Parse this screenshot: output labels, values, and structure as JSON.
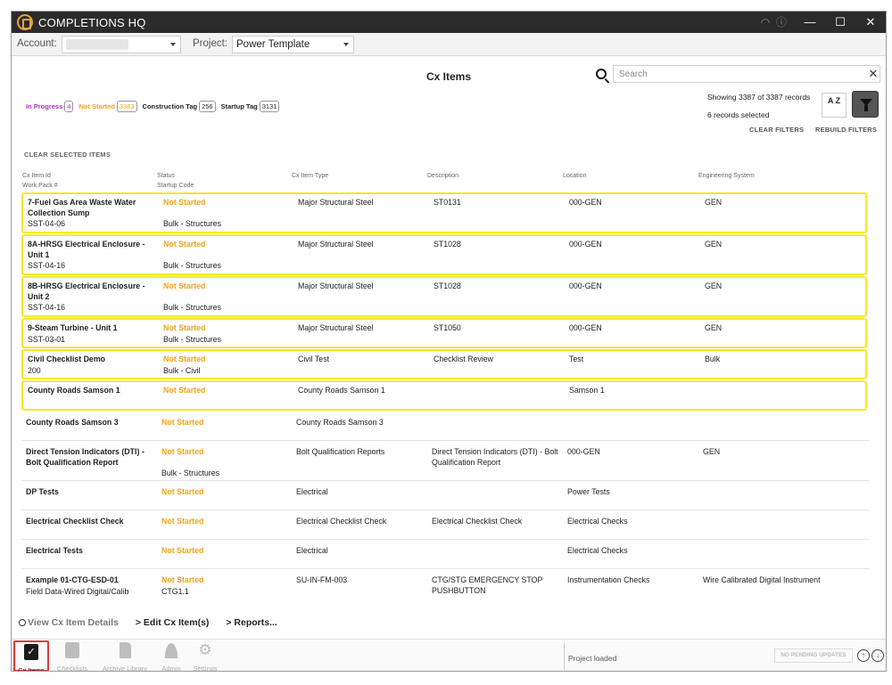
{
  "app": {
    "title": "COMPLETIONS HQ",
    "titlebar_icons": [
      "wifi-icon",
      "info-icon"
    ]
  },
  "account": {
    "label": "Account:",
    "value": ""
  },
  "project": {
    "label": "Project:",
    "value": "Power Template"
  },
  "page": {
    "title": "Cx Items"
  },
  "search": {
    "placeholder": "Search",
    "value": "",
    "clear": "✕"
  },
  "chips": [
    {
      "label": "In Progress",
      "count": "4",
      "color": "#b02cc7"
    },
    {
      "label": "Not Started",
      "count": "3383",
      "color": "#f2a31d"
    },
    {
      "label": "Construction Tag",
      "count": "256",
      "color": "#222222"
    },
    {
      "label": "Startup Tag",
      "count": "3131",
      "color": "#222222"
    }
  ],
  "records": {
    "count_text": "Showing 3387 of 3387 records",
    "selected_text": "6 records selected"
  },
  "sort_label": "A Z",
  "links": {
    "clear_filters": "CLEAR FILTERS",
    "rebuild_filters": "REBUILD FILTERS",
    "clear_selected": "CLEAR SELECTED ITEMS"
  },
  "columns": {
    "id": "Cx Item Id",
    "work_pack": "Work Pack #",
    "status": "Status",
    "startup_code": "Startup Code",
    "type": "Cx Item Type",
    "description": "Description",
    "location": "Location",
    "eng_system": "Engineering System"
  },
  "rows": [
    {
      "name": "7-Fuel Gas Area Waste Water Collection Sump",
      "work_pack": "SST-04-06",
      "status": "Not Started",
      "startup": "Bulk - Structures",
      "type": "Major Structural Steel",
      "description": "ST0131",
      "location": "000-GEN",
      "eng": "GEN",
      "selected": true
    },
    {
      "name": "8A-HRSG Electrical Enclosure - Unit 1",
      "work_pack": "SST-04-16",
      "status": "Not Started",
      "startup": "Bulk - Structures",
      "type": "Major Structural Steel",
      "description": "ST1028",
      "location": "000-GEN",
      "eng": "GEN",
      "selected": true
    },
    {
      "name": "8B-HRSG Electrical Enclosure - Unit 2",
      "work_pack": "SST-04-16",
      "status": "Not Started",
      "startup": "Bulk - Structures",
      "type": "Major Structural Steel",
      "description": "ST1028",
      "location": "000-GEN",
      "eng": "GEN",
      "selected": true
    },
    {
      "name": "9-Steam Turbine - Unit 1",
      "work_pack": "SST-03-01",
      "status": "Not Started",
      "startup": "Bulk - Structures",
      "type": "Major Structural Steel",
      "description": "ST1050",
      "location": "000-GEN",
      "eng": "GEN",
      "selected": true
    },
    {
      "name": "Civil Checklist Demo",
      "work_pack": "200",
      "status": "Not Started",
      "startup": "Bulk - Civil",
      "type": "Civil Test",
      "description": "Checklist Review",
      "location": "Test",
      "eng": "Bulk",
      "selected": true
    },
    {
      "name": "County Roads Samson 1",
      "work_pack": "",
      "status": "Not Started",
      "startup": "",
      "type": "County Roads Samson 1",
      "description": "",
      "location": "Samson 1",
      "eng": "",
      "selected": true
    },
    {
      "name": "County Roads Samson 3",
      "work_pack": "",
      "status": "Not Started",
      "startup": "",
      "type": "County Roads Samson 3",
      "description": "",
      "location": "",
      "eng": "",
      "selected": false
    },
    {
      "name": "Direct Tension Indicators (DTI) - Bolt Qualification Report",
      "work_pack": "",
      "status": "Not Started",
      "startup": "Bulk - Structures",
      "type": "Bolt Qualification Reports",
      "description": "Direct Tension Indicators (DTI) - Bolt Qualification Report",
      "location": "000-GEN",
      "eng": "GEN",
      "selected": false
    },
    {
      "name": "DP Tests",
      "work_pack": "",
      "status": "Not Started",
      "startup": "",
      "type": "Electrical",
      "description": "",
      "location": "Power Tests",
      "eng": "",
      "selected": false
    },
    {
      "name": "Electrical Checklist Check",
      "work_pack": "",
      "status": "Not Started",
      "startup": "",
      "type": "Electrical Checklist Check",
      "description": "Electrical Checklist Check",
      "location": "Electrical Checks",
      "eng": "",
      "selected": false
    },
    {
      "name": "Electrical Tests",
      "work_pack": "",
      "status": "Not Started",
      "startup": "",
      "type": "Electrical",
      "description": "",
      "location": "Electrical Checks",
      "eng": "",
      "selected": false
    },
    {
      "name": "Example 01-CTG-ESD-01",
      "work_pack": "Field Data-Wired Digital/Calib",
      "status": "Not Started",
      "startup": "CTG1.1",
      "type": "SU-IN-FM-003",
      "description": "CTG/STG EMERGENCY STOP PUSHBUTTON",
      "location": "Instrumentation Checks",
      "eng": "Wire Calibrated Digital Instrument",
      "selected": false
    }
  ],
  "actions": {
    "view": "View Cx Item Details",
    "edit": "Edit Cx Item(s)",
    "reports": "Reports..."
  },
  "nav": [
    {
      "label": "Cx Items",
      "icon": "clipboard-check-icon",
      "active": true
    },
    {
      "label": "Checklists",
      "icon": "checklist-icon",
      "active": false
    },
    {
      "label": "Archive Library",
      "icon": "document-icon",
      "active": false
    },
    {
      "label": "Admin",
      "icon": "admin-user-icon",
      "active": false
    },
    {
      "label": "Settings",
      "icon": "gear-icon",
      "active": false
    }
  ],
  "status_bar": {
    "text": "Project loaded",
    "pending": "NO PENDING UPDATES"
  }
}
